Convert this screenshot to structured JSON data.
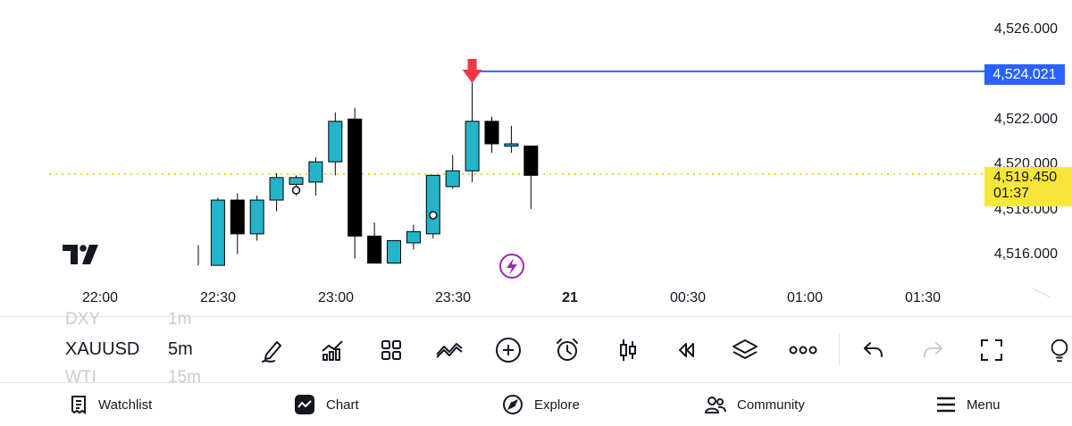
{
  "chart": {
    "symbol": "XAUUSD",
    "interval": "5m",
    "price_axis_labels": [
      "4,526.000",
      "4,522.000",
      "4,520.000",
      "4,518.000",
      "4,516.000"
    ],
    "time_axis_labels": [
      "22:00",
      "22:30",
      "23:00",
      "23:30",
      "21",
      "00:30",
      "01:00",
      "01:30"
    ],
    "alert_price": "4,524.021",
    "current_price": "4,519.450",
    "countdown": "01:37",
    "colors": {
      "up": "#22b5c9",
      "down": "#000000",
      "alert_line": "#2962ff",
      "price_line": "#f2d22a",
      "arrow": "#f23645",
      "lightning": "#9c27b0"
    }
  },
  "chart_data": {
    "type": "candlestick",
    "x": [
      "22:25",
      "22:30",
      "22:35",
      "22:40",
      "22:45",
      "22:50",
      "22:55",
      "23:00",
      "23:05",
      "23:10",
      "23:15",
      "23:20",
      "23:25",
      "23:30",
      "23:35",
      "23:40",
      "23:45",
      "23:50"
    ],
    "ohlc": [
      [
        null,
        4516.3,
        4515.4,
        null
      ],
      [
        4515.4,
        4518.4,
        4515.4,
        4518.3
      ],
      [
        4518.3,
        4518.6,
        4515.9,
        4516.8
      ],
      [
        4516.8,
        4518.5,
        4516.5,
        4518.3
      ],
      [
        4518.3,
        4519.5,
        4517.8,
        4519.3
      ],
      [
        4519.0,
        4519.4,
        4518.5,
        4519.3
      ],
      [
        4519.1,
        4520.2,
        4518.5,
        4520.0
      ],
      [
        4520.0,
        4522.2,
        4519.4,
        4521.8
      ],
      [
        4521.9,
        4522.4,
        4515.7,
        4516.7
      ],
      [
        4516.7,
        4517.3,
        4515.5,
        4515.5
      ],
      [
        4515.5,
        4516.5,
        4515.5,
        4516.5
      ],
      [
        4516.4,
        4517.2,
        4516.1,
        4516.9
      ],
      [
        4516.8,
        4518.3,
        4516.6,
        4519.4
      ],
      [
        4518.9,
        4520.3,
        4518.8,
        4519.6
      ],
      [
        4519.6,
        4523.9,
        4519.1,
        4521.8
      ],
      [
        4521.8,
        4522.0,
        4520.4,
        4520.8
      ],
      [
        4520.7,
        4521.6,
        4520.4,
        4520.8
      ],
      [
        4520.7,
        4520.6,
        4517.9,
        4519.4
      ]
    ],
    "ylim": [
      4515.4,
      4526.0
    ],
    "horizontal_lines": [
      {
        "name": "alert",
        "value": 4524.021
      },
      {
        "name": "current",
        "value": 4519.45
      }
    ]
  },
  "toolbar": {
    "symbols_above": {
      "symbol": "DXY",
      "interval": "1m"
    },
    "symbols_below": {
      "symbol": "WTI",
      "interval": "15m"
    },
    "icons": [
      "pen-icon",
      "indicators-icon",
      "layout-icon",
      "compare-icon",
      "add-icon",
      "alarm-icon",
      "bar-style-icon",
      "replay-icon",
      "layers-icon",
      "more-icon",
      "undo-icon",
      "redo-icon",
      "fullscreen-icon",
      "lightbulb-icon"
    ]
  },
  "nav": {
    "watchlist": "Watchlist",
    "chart": "Chart",
    "explore": "Explore",
    "community": "Community",
    "menu": "Menu"
  }
}
